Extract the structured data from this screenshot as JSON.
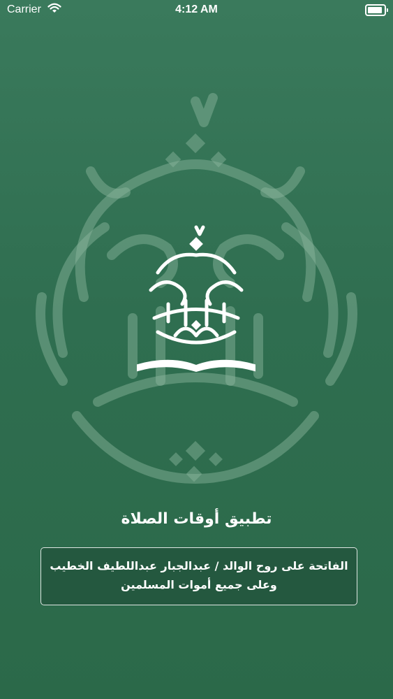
{
  "status_bar": {
    "carrier": "Carrier",
    "time": "4:12 AM",
    "wifi_icon": "wifi-icon",
    "battery_icon": "battery-icon"
  },
  "splash": {
    "app_title": "تطبيق أوقات الصلاة",
    "dedication": {
      "line1": "الفاتحة على روح  الوالد / عبدالجبار عبداللطيف الخطيب",
      "line2": "وعلى جميع أموات المسلمين"
    },
    "background_art": "islamic-calligraphy-emblem",
    "logo": "quran-book-emblem"
  },
  "colors": {
    "background_top": "#3a7a5c",
    "background_bottom": "#2b6949",
    "box_background": "#24583f",
    "text": "#ffffff"
  }
}
